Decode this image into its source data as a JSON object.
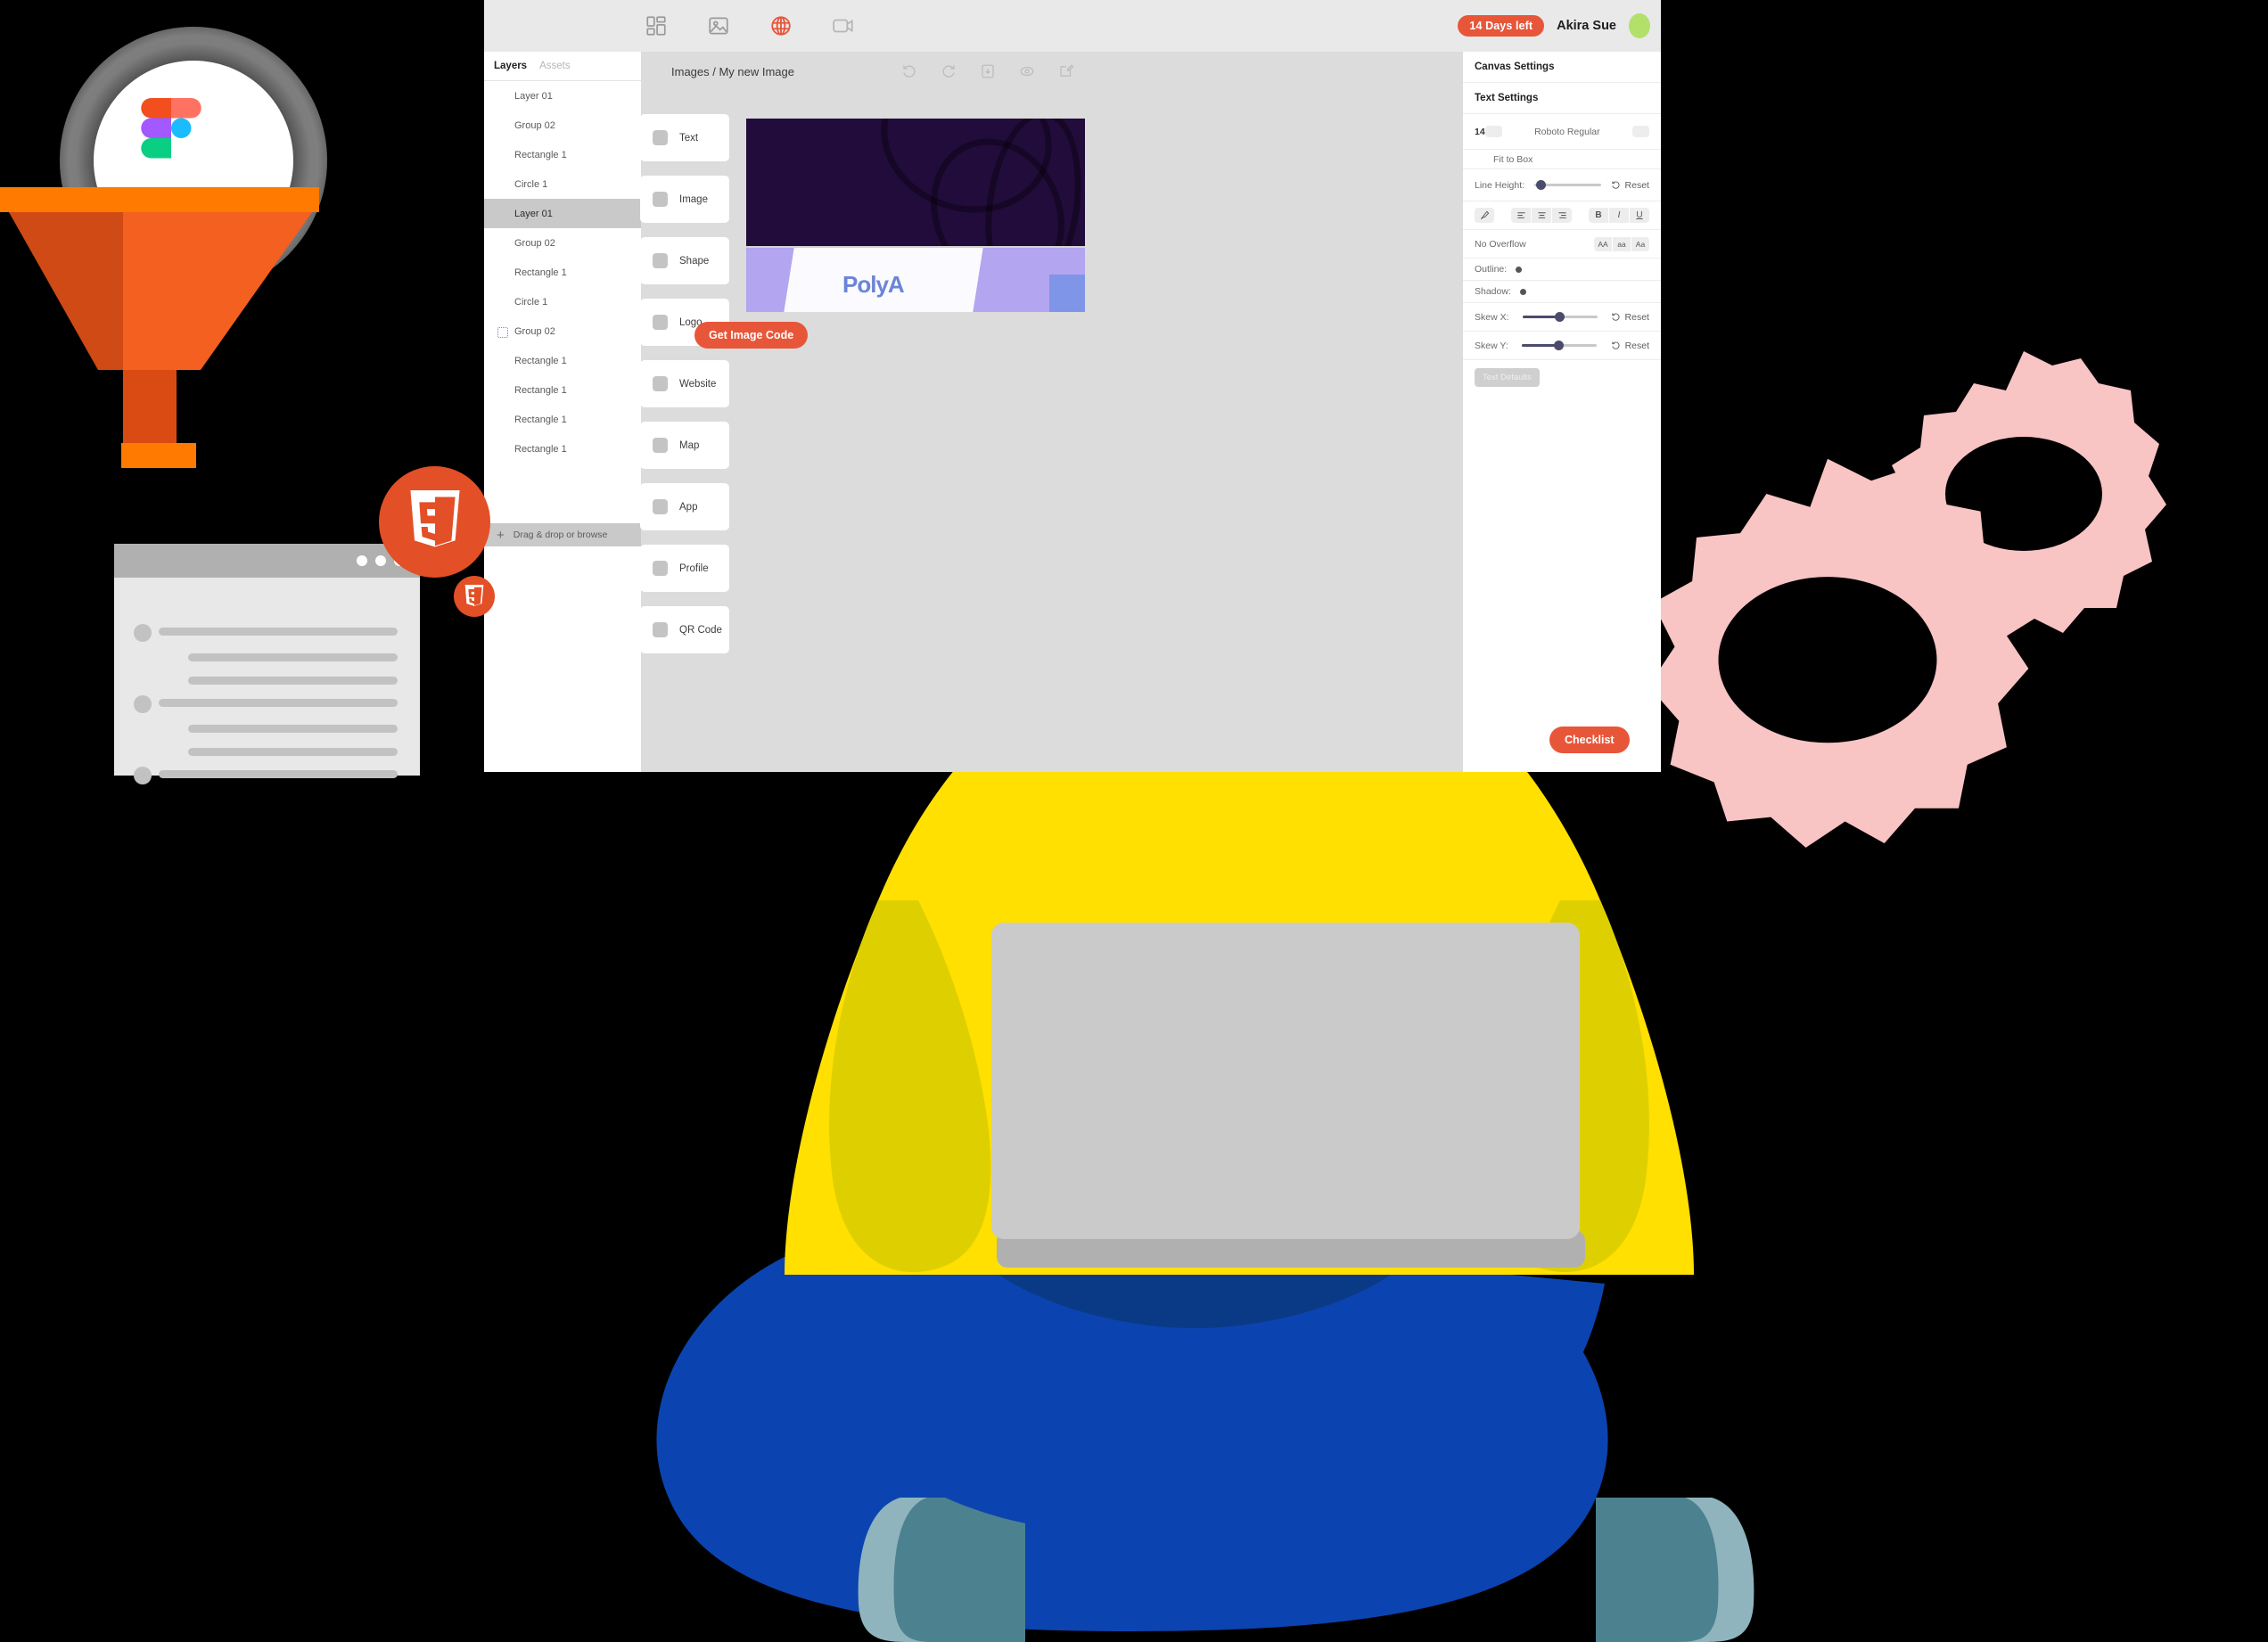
{
  "app": {
    "topbar": {
      "icons": [
        {
          "name": "dashboard-icon",
          "label": "Dashboard"
        },
        {
          "name": "image-icon",
          "label": "Images"
        },
        {
          "name": "globe-icon",
          "label": "Website"
        },
        {
          "name": "video-icon",
          "label": "Video"
        }
      ],
      "trial_badge": "14 Days left",
      "user_name": "Akira Sue",
      "avatar_color": "#b2e06a"
    },
    "layers_panel": {
      "tab_layers": "Layers",
      "tab_assets": "Assets",
      "items": [
        {
          "label": "Layer 01",
          "selected": false,
          "group": false
        },
        {
          "label": "Group 02",
          "selected": false,
          "group": false
        },
        {
          "label": "Rectangle 1",
          "selected": false,
          "group": false
        },
        {
          "label": "Circle 1",
          "selected": false,
          "group": false
        },
        {
          "label": "Layer 01",
          "selected": true,
          "group": false
        },
        {
          "label": "Group 02",
          "selected": false,
          "group": false
        },
        {
          "label": "Rectangle 1",
          "selected": false,
          "group": false
        },
        {
          "label": "Circle 1",
          "selected": false,
          "group": false
        },
        {
          "label": "Group 02",
          "selected": false,
          "group": true
        },
        {
          "label": "Rectangle 1",
          "selected": false,
          "group": false
        },
        {
          "label": "Rectangle 1",
          "selected": false,
          "group": false
        },
        {
          "label": "Rectangle 1",
          "selected": false,
          "group": false
        },
        {
          "label": "Rectangle 1",
          "selected": false,
          "group": false
        }
      ],
      "drag_drop": "Drag & drop or browse"
    },
    "canvas": {
      "breadcrumb": "Images / My new Image",
      "tools": [
        {
          "name": "undo-icon",
          "label": "Undo"
        },
        {
          "name": "redo-icon",
          "label": "Redo"
        },
        {
          "name": "save-icon",
          "label": "Save"
        },
        {
          "name": "preview-eye-icon",
          "label": "Preview"
        },
        {
          "name": "edit-icon",
          "label": "Edit"
        }
      ],
      "palette": [
        {
          "label": "Text"
        },
        {
          "label": "Image"
        },
        {
          "label": "Shape"
        },
        {
          "label": "Logo"
        },
        {
          "label": "Website"
        },
        {
          "label": "Map"
        },
        {
          "label": "App"
        },
        {
          "label": "Profile"
        },
        {
          "label": "QR Code"
        }
      ],
      "stage_text": "PolyA",
      "get_image_code": "Get Image Code"
    },
    "settings": {
      "canvas_settings": "Canvas Settings",
      "text_settings": "Text Settings",
      "font_size": "14",
      "font_family": "Roboto Regular",
      "fit_to_box": "Fit to Box",
      "line_height_label": "Line Height:",
      "line_height_reset": "Reset",
      "align_buttons": [
        "align-left",
        "align-center",
        "align-right"
      ],
      "style_buttons": [
        "B",
        "I",
        "U"
      ],
      "overflow_label": "No Overflow",
      "case_buttons": [
        "AA",
        "aa",
        "Aa"
      ],
      "outline_label": "Outline:",
      "shadow_label": "Shadow:",
      "skew_x_label": "Skew X:",
      "skew_x_reset": "Reset",
      "skew_y_label": "Skew Y:",
      "skew_y_reset": "Reset",
      "text_defaults": "Text Defaults"
    },
    "checklist_button": "Checklist"
  },
  "decor": {
    "figma_logo": "figma-logo",
    "funnel": "funnel-illustration",
    "html5_badge_large": "html5-logo",
    "html5_badge_small": "html5-logo",
    "browser_mockup": "browser-window-mockup",
    "gear_small": "gear-icon",
    "gear_large": "gear-icon",
    "person": "person-with-laptop-illustration"
  },
  "colors": {
    "accent_orange": "#e8563a",
    "funnel_orange": "#ff7a00",
    "funnel_shadow": "#d94b12",
    "html5_red": "#e34f26",
    "gear_pink": "#f9c4c4",
    "shirt_yellow": "#ffe000",
    "pants_blue": "#0b44b0",
    "hair_navy": "#1b1b8f",
    "skin": "#f7a181",
    "avatar_green": "#b2e06a",
    "stage_dark": "#220c3b",
    "stage_purple": "#b3a5ef"
  }
}
